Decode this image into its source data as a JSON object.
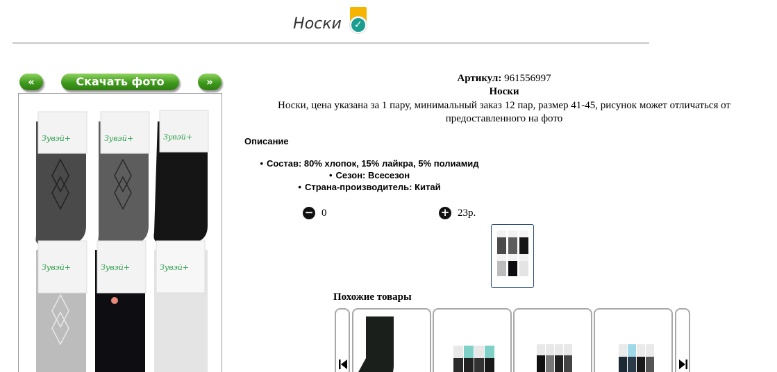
{
  "header": {
    "title": "Носки",
    "badge_icon": "verified-check-icon"
  },
  "nav": {
    "prev_label": "«",
    "download_label": "Скачать фото",
    "next_label": "»"
  },
  "product": {
    "article_label": "Артикул:",
    "article_value": "961556997",
    "name": "Носки",
    "description": "Носки, цена указана за 1 пару, минимальный заказ 12 пар, размер 41-45, рисунок может отличаться от предоставленного на фото",
    "desc_heading": "Описание",
    "specs": [
      "Состав: 80% хлопок, 15% лайкра, 5% полиамид",
      "Сезон: Всесезон",
      "Страна-производитель: Китай"
    ],
    "photo_pack_labels": [
      "Зувэй+",
      "Зувэй+",
      "Зувэй+",
      "Зувэй+",
      "Зувэй+",
      "Зувэй+"
    ],
    "quantity": "0",
    "price": "23р."
  },
  "similar": {
    "heading": "Похожие товары"
  },
  "colors": {
    "accent_green": "#3f9a1d",
    "badge_yellow": "#f4b400",
    "badge_teal": "#1b9e8f"
  }
}
